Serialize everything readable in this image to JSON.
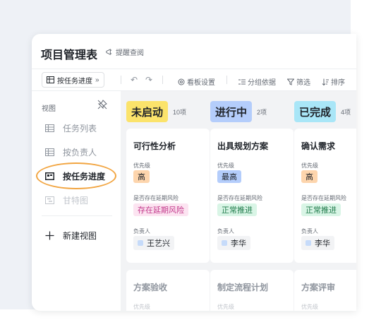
{
  "app": {
    "title": "项目管理表",
    "remind": "提醒查阅"
  },
  "toolbar": {
    "current_view": "按任务进度",
    "collapse": "»",
    "undo": "↶",
    "redo": "↷",
    "items": [
      {
        "label": "看板设置"
      },
      {
        "label": "分组依据"
      },
      {
        "label": "筛选"
      },
      {
        "label": "排序"
      }
    ]
  },
  "sidebar": {
    "header": "视图",
    "items": [
      {
        "label": "任务列表",
        "icon": "table-icon"
      },
      {
        "label": "按负责人",
        "icon": "table-icon"
      },
      {
        "label": "按任务进度",
        "icon": "kanban-icon",
        "active": true
      },
      {
        "label": "甘特图",
        "icon": "gantt-icon"
      }
    ],
    "new_view": "新建视图"
  },
  "columns": [
    {
      "status": "未启动",
      "count": "10项",
      "color": "#fbe36b",
      "card": {
        "title": "可行性分析",
        "priority_label": "优先级",
        "priority": "高",
        "priority_bg": "#fdd5ad",
        "risk_label": "是否存在延期风险",
        "risk": "存在延期风险",
        "risk_bg": "#fce4f1",
        "risk_color": "#c2378a",
        "owner_label": "负责人",
        "owner": "王艺兴"
      },
      "next_card": {
        "title": "方案验收",
        "priority_label": "优先级"
      }
    },
    {
      "status": "进行中",
      "count": "2项",
      "color": "#b4cdfb",
      "card": {
        "title": "出具规划方案",
        "priority_label": "优先级",
        "priority": "最高",
        "priority_bg": "#b4cdfb",
        "risk_label": "是否存在延期风险",
        "risk": "正常推进",
        "risk_bg": "#d9f5e6",
        "risk_color": "#1f7a4a",
        "owner_label": "负责人",
        "owner": "李华"
      },
      "next_card": {
        "title": "制定流程计划",
        "priority_label": "优先级"
      }
    },
    {
      "status": "已完成",
      "count": "4项",
      "color": "#a9e6f7",
      "card": {
        "title": "确认需求",
        "priority_label": "优先级",
        "priority": "高",
        "priority_bg": "#fdd5ad",
        "risk_label": "是否存在延期风险",
        "risk": "正常推进",
        "risk_bg": "#d9f5e6",
        "risk_color": "#1f7a4a",
        "owner_label": "负责人",
        "owner": "李华"
      },
      "next_card": {
        "title": "方案评审",
        "priority_label": "优先级"
      }
    }
  ]
}
